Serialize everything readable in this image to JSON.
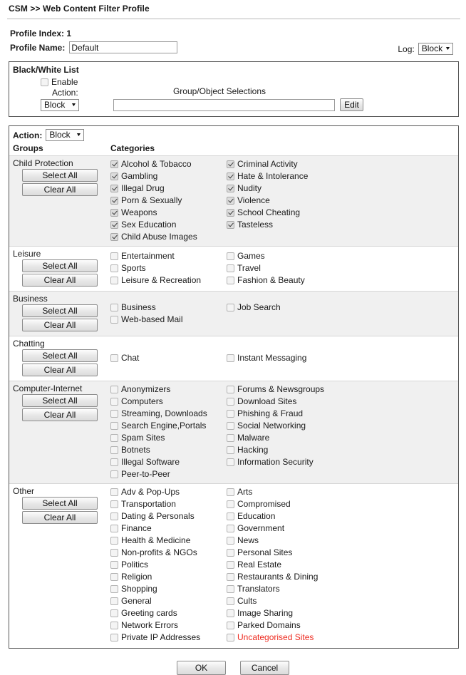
{
  "breadcrumb": "CSM >> Web Content Filter Profile",
  "profile": {
    "index_label": "Profile Index: 1",
    "name_label": "Profile Name:",
    "name_value": "Default",
    "log_label": "Log:",
    "log_value": "Block"
  },
  "blackwhite": {
    "title": "Black/White List",
    "enable_label": "Enable",
    "enable_checked": false,
    "action_label": "Action:",
    "action_value": "Block",
    "selections_title": "Group/Object Selections",
    "selections_value": "",
    "edit_label": "Edit"
  },
  "categories_panel": {
    "action_label": "Action:",
    "action_value": "Block",
    "col_groups": "Groups",
    "col_categories": "Categories",
    "select_all_label": "Select All",
    "clear_all_label": "Clear All",
    "groups": [
      {
        "name": "Child Protection",
        "shaded": true,
        "items": [
          {
            "label": "Alcohol & Tobacco",
            "checked": true
          },
          {
            "label": "Criminal Activity",
            "checked": true
          },
          {
            "label": "Gambling",
            "checked": true
          },
          {
            "label": "Hate & Intolerance",
            "checked": true
          },
          {
            "label": "Illegal Drug",
            "checked": true
          },
          {
            "label": "Nudity",
            "checked": true
          },
          {
            "label": "Porn & Sexually",
            "checked": true
          },
          {
            "label": "Violence",
            "checked": true
          },
          {
            "label": "Weapons",
            "checked": true
          },
          {
            "label": "School Cheating",
            "checked": true
          },
          {
            "label": "Sex Education",
            "checked": true
          },
          {
            "label": "Tasteless",
            "checked": true
          },
          {
            "label": "Child Abuse Images",
            "checked": true
          }
        ]
      },
      {
        "name": "Leisure",
        "shaded": false,
        "items": [
          {
            "label": "Entertainment",
            "checked": false
          },
          {
            "label": "Games",
            "checked": false
          },
          {
            "label": "Sports",
            "checked": false
          },
          {
            "label": "Travel",
            "checked": false
          },
          {
            "label": "Leisure & Recreation",
            "checked": false
          },
          {
            "label": "Fashion & Beauty",
            "checked": false
          }
        ]
      },
      {
        "name": "Business",
        "shaded": true,
        "items": [
          {
            "label": "Business",
            "checked": false
          },
          {
            "label": "Job Search",
            "checked": false
          },
          {
            "label": "Web-based Mail",
            "checked": false
          }
        ]
      },
      {
        "name": "Chatting",
        "shaded": false,
        "items": [
          {
            "label": "Chat",
            "checked": false
          },
          {
            "label": "Instant Messaging",
            "checked": false
          }
        ]
      },
      {
        "name": "Computer-Internet",
        "shaded": true,
        "items": [
          {
            "label": "Anonymizers",
            "checked": false
          },
          {
            "label": "Forums & Newsgroups",
            "checked": false
          },
          {
            "label": "Computers",
            "checked": false
          },
          {
            "label": "Download Sites",
            "checked": false
          },
          {
            "label": "Streaming, Downloads",
            "checked": false
          },
          {
            "label": "Phishing & Fraud",
            "checked": false
          },
          {
            "label": "Search Engine,Portals",
            "checked": false
          },
          {
            "label": "Social Networking",
            "checked": false
          },
          {
            "label": "Spam Sites",
            "checked": false
          },
          {
            "label": "Malware",
            "checked": false
          },
          {
            "label": "Botnets",
            "checked": false
          },
          {
            "label": "Hacking",
            "checked": false
          },
          {
            "label": "Illegal Software",
            "checked": false
          },
          {
            "label": "Information Security",
            "checked": false
          },
          {
            "label": "Peer-to-Peer",
            "checked": false
          }
        ]
      },
      {
        "name": "Other",
        "shaded": false,
        "items": [
          {
            "label": "Adv & Pop-Ups",
            "checked": false
          },
          {
            "label": "Arts",
            "checked": false
          },
          {
            "label": "Transportation",
            "checked": false
          },
          {
            "label": "Compromised",
            "checked": false
          },
          {
            "label": "Dating & Personals",
            "checked": false
          },
          {
            "label": "Education",
            "checked": false
          },
          {
            "label": "Finance",
            "checked": false
          },
          {
            "label": "Government",
            "checked": false
          },
          {
            "label": "Health & Medicine",
            "checked": false
          },
          {
            "label": "News",
            "checked": false
          },
          {
            "label": "Non-profits & NGOs",
            "checked": false
          },
          {
            "label": "Personal Sites",
            "checked": false
          },
          {
            "label": "Politics",
            "checked": false
          },
          {
            "label": "Real Estate",
            "checked": false
          },
          {
            "label": "Religion",
            "checked": false
          },
          {
            "label": "Restaurants & Dining",
            "checked": false
          },
          {
            "label": "Shopping",
            "checked": false
          },
          {
            "label": "Translators",
            "checked": false
          },
          {
            "label": "General",
            "checked": false
          },
          {
            "label": "Cults",
            "checked": false
          },
          {
            "label": "Greeting cards",
            "checked": false
          },
          {
            "label": "Image Sharing",
            "checked": false
          },
          {
            "label": "Network Errors",
            "checked": false
          },
          {
            "label": "Parked Domains",
            "checked": false
          },
          {
            "label": "Private IP Addresses",
            "checked": false
          },
          {
            "label": "Uncategorised Sites",
            "checked": false,
            "flagged": true
          }
        ]
      }
    ]
  },
  "footer": {
    "ok_label": "OK",
    "cancel_label": "Cancel"
  },
  "colors": {
    "flagged_text": "#ee2b20",
    "row_shaded": "#f0f0f0",
    "panel_border": "#555555"
  }
}
